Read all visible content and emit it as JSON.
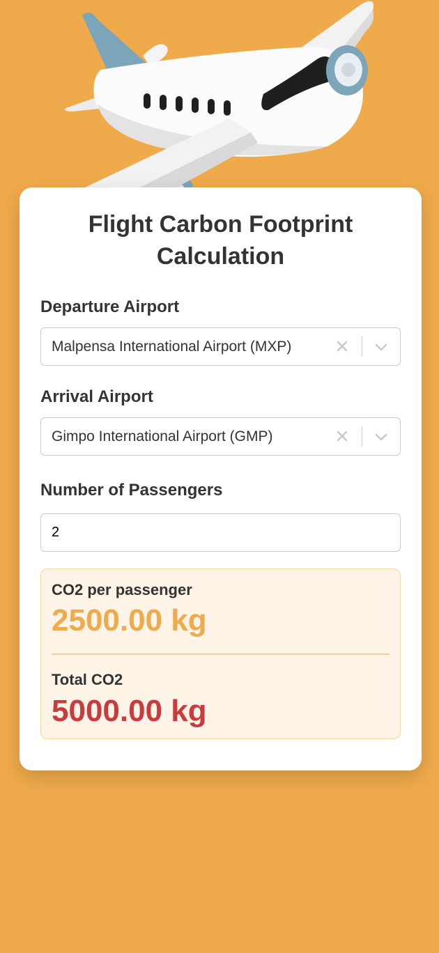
{
  "title": "Flight Carbon Footprint Calculation",
  "departure": {
    "label": "Departure Airport",
    "value": "Malpensa International Airport (MXP)"
  },
  "arrival": {
    "label": "Arrival Airport",
    "value": "Gimpo International Airport (GMP)"
  },
  "passengers": {
    "label": "Number of Passengers",
    "value": "2"
  },
  "results": {
    "per_passenger_label": "CO2 per passenger",
    "per_passenger_value": "2500.00 kg",
    "total_label": "Total CO2",
    "total_value": "5000.00 kg"
  },
  "colors": {
    "background": "#EFAA4B",
    "accent": "#EFAA4B",
    "total": "#C93B3F",
    "result_bg": "#FDF3E7"
  },
  "icons": {
    "hero": "airplane-illustration",
    "clear": "close-icon",
    "dropdown": "chevron-down-icon"
  }
}
